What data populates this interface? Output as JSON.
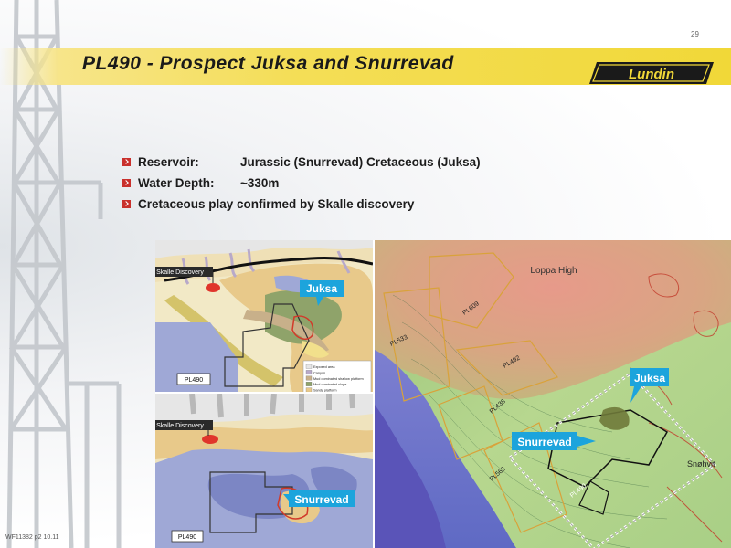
{
  "page_number": "29",
  "title": "PL490 - Prospect Juksa and Snurrevad",
  "logo_text": "Lundin",
  "bullets": [
    {
      "label": "Reservoir:",
      "value": "Jurassic (Snurrevad) Cretaceous (Juksa)"
    },
    {
      "label": "Water Depth:",
      "value": "~330m"
    },
    {
      "label": "Cretaceous play confirmed by Skalle discovery",
      "value": ""
    }
  ],
  "left_map_top": {
    "skalle_label": "Skalle Discovery",
    "callout": "Juksa",
    "licence_label": "PL490",
    "legend": [
      {
        "text": "Exposed area",
        "color": "#e6e6e6"
      },
      {
        "text": "Canyon",
        "color": "#b8a9c9"
      },
      {
        "text": "Mud dominated shallow platform",
        "color": "#c8b08a"
      },
      {
        "text": "Mud dominated slope",
        "color": "#8fa36a"
      },
      {
        "text": "Sandy platform",
        "color": "#e8c98a"
      },
      {
        "text": "Sandy submarine fan",
        "color": "#f2e08c"
      },
      {
        "text": "Mixed sandy/Muddy submarine fan",
        "color": "#d4c36a"
      },
      {
        "text": "Basin fines",
        "color": "#9fa8d6"
      },
      {
        "text": "Basin high",
        "color": "#7c86c4"
      }
    ]
  },
  "left_map_bottom": {
    "skalle_label": "Skalle Discovery",
    "callout": "Snurrevad",
    "licence_label": "PL490"
  },
  "right_map": {
    "loppa_high": "Loppa High",
    "licences": [
      "PL609",
      "PL533",
      "PL492",
      "PL438",
      "PL563",
      "PL490"
    ],
    "callout_juksa": "Juksa",
    "callout_snurrevad": "Snurrevad",
    "snohvit": "Snøhvit"
  },
  "footer": "WF11382 p2 10.11",
  "colors": {
    "accent_yellow": "#f1d838",
    "callout_blue": "#1ca4dc",
    "bullet_red": "#c9302c"
  }
}
